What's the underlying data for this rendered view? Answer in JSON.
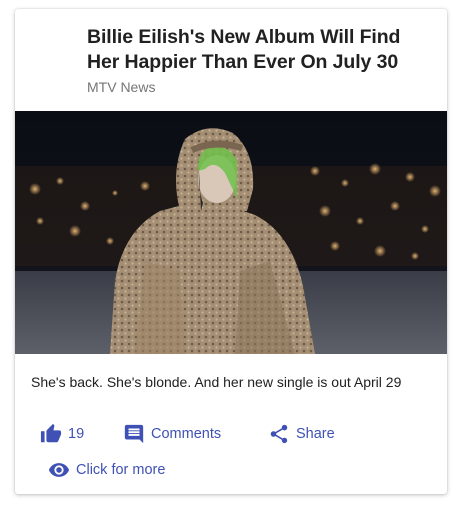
{
  "article": {
    "title": "Billie Eilish's New Album Will Find Her Happier Than Ever On July 30",
    "source": "MTV News",
    "description": "She's back. She's blonde. And her new single is out April 29"
  },
  "actions": {
    "likes": "19",
    "comments_label": "Comments",
    "share_label": "Share",
    "more_label": "Click for more"
  },
  "icons": {
    "like": "thumbs-up-icon",
    "comments": "comment-icon",
    "share": "share-icon",
    "more": "eye-icon"
  },
  "colors": {
    "accent": "#3f51b5",
    "title": "#212121",
    "source": "#757575"
  }
}
